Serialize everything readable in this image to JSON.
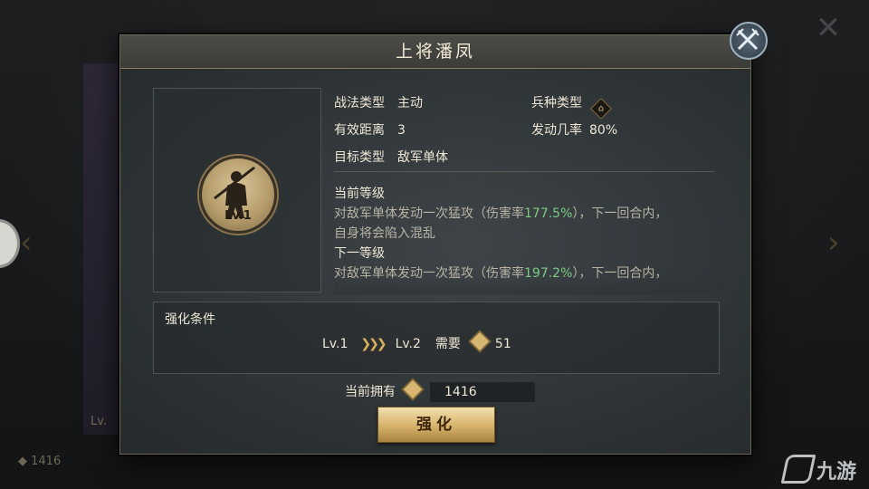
{
  "dialog": {
    "title": "上将潘凤"
  },
  "portrait": {
    "level": "Lv.1"
  },
  "info": {
    "tactic_type_label": "战法类型",
    "tactic_type_value": "主动",
    "unit_type_label": "兵种类型",
    "range_label": "有效距离",
    "range_value": "3",
    "trigger_rate_label": "发动几率",
    "trigger_rate_value": "80%",
    "target_label": "目标类型",
    "target_value": "敌军单体"
  },
  "current_level": {
    "heading": "当前等级",
    "text_prefix": "对敌军单体发动一次猛攻（伤害率",
    "damage_rate": "177.5%",
    "text_suffix": "），下一回合内，",
    "text_line2": "自身将会陷入混乱"
  },
  "next_level": {
    "heading": "下一等级",
    "text_prefix": "对敌军单体发动一次猛攻（伤害率",
    "damage_rate": "197.2%",
    "text_suffix": "），下一回合内，"
  },
  "enhance_condition": {
    "title": "强化条件",
    "from_level": "Lv.1",
    "to_level": "Lv.2",
    "need_label": "需要",
    "need_amount": "51"
  },
  "owned": {
    "label": "当前拥有",
    "amount": "1416"
  },
  "buttons": {
    "enhance_label": "强化"
  },
  "background": {
    "ghost_level": "Lv.",
    "ghost_resource": "1416"
  },
  "watermark": {
    "text": "九游"
  },
  "colors": {
    "highlight_green": "#7ccc84",
    "gold_button": "#d6b26a"
  },
  "icons": {
    "close": "crossed-swords-close-icon",
    "unit_type": "cavalry-icon",
    "currency": "tactic-token-icon"
  }
}
